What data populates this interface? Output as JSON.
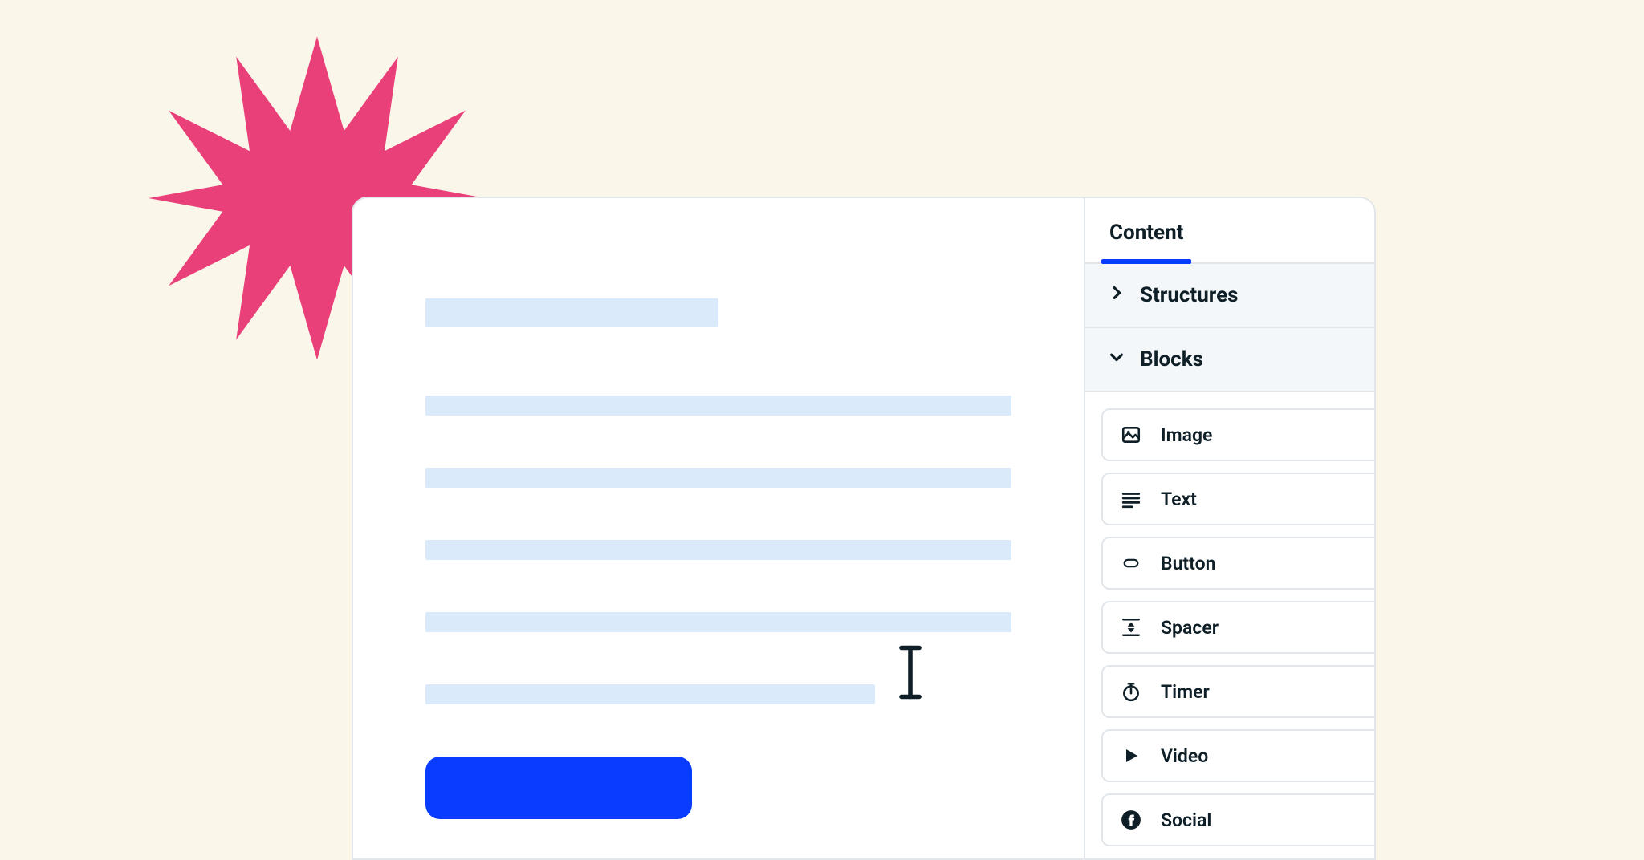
{
  "colors": {
    "background": "#fbf6ea",
    "accent": "#0a3cff",
    "starburst": "#e9407a",
    "placeholder": "#dbeafa",
    "ink": "#0f1f27",
    "line": "#e2e6ea"
  },
  "sidebar": {
    "tabs": [
      {
        "label": "Content",
        "active": true
      }
    ],
    "sections": {
      "structures": {
        "label": "Structures",
        "expanded": false,
        "chevron_icon": "chevron-right-icon"
      },
      "blocks": {
        "label": "Blocks",
        "expanded": true,
        "chevron_icon": "chevron-down-icon"
      }
    },
    "blocks": [
      {
        "key": "image",
        "label": "Image",
        "icon": "image-icon"
      },
      {
        "key": "text",
        "label": "Text",
        "icon": "text-lines-icon"
      },
      {
        "key": "button",
        "label": "Button",
        "icon": "button-pill-icon"
      },
      {
        "key": "spacer",
        "label": "Spacer",
        "icon": "spacer-icon"
      },
      {
        "key": "timer",
        "label": "Timer",
        "icon": "stopwatch-icon"
      },
      {
        "key": "video",
        "label": "Video",
        "icon": "play-icon"
      },
      {
        "key": "social",
        "label": "Social",
        "icon": "facebook-icon"
      }
    ]
  },
  "canvas": {
    "cta_button_label": ""
  }
}
